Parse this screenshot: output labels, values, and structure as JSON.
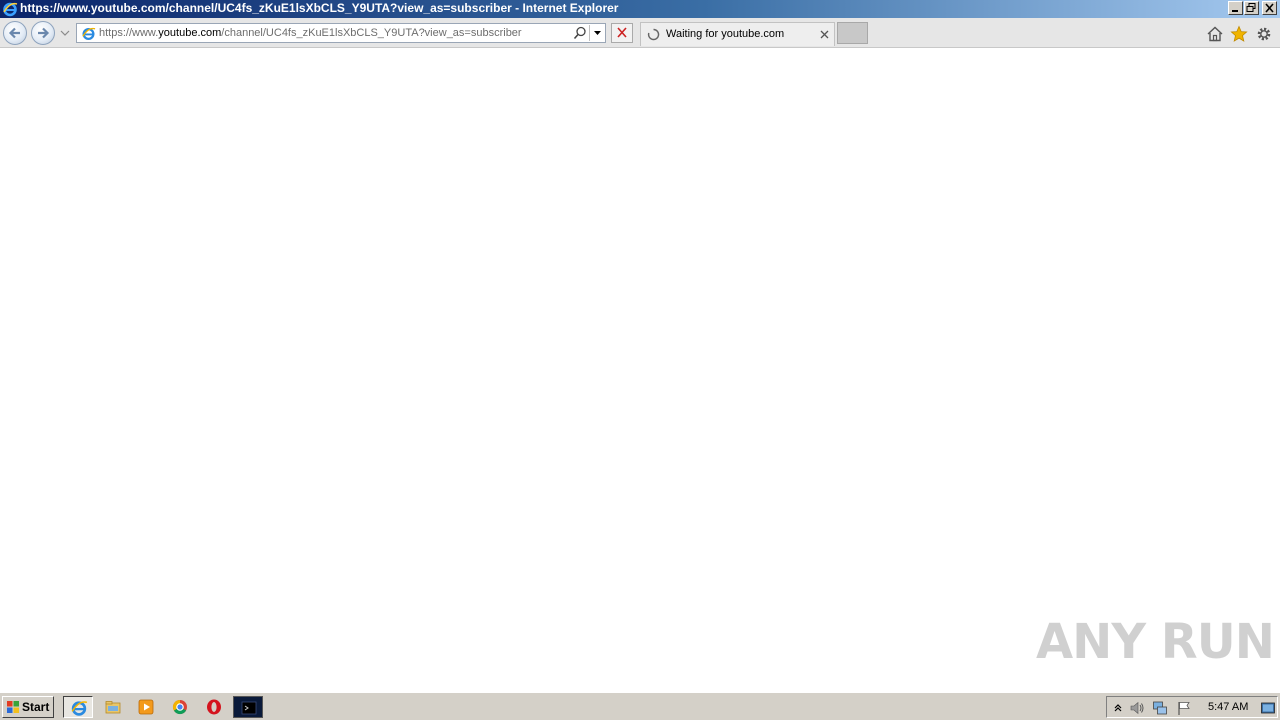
{
  "window": {
    "title": "https://www.youtube.com/channel/UC4fs_zKuE1lsXbCLS_Y9UTA?view_as=subscriber - Internet Explorer"
  },
  "address": {
    "prefix": "https://www.",
    "host": "youtube.com",
    "path": "/channel/UC4fs_zKuE1lsXbCLS_Y9UTA?view_as=subscriber"
  },
  "tab": {
    "label": "Waiting for youtube.com"
  },
  "watermark": {
    "text": "ANY RUN"
  },
  "taskbar": {
    "start_label": "Start",
    "items": [
      "internet-explorer",
      "file-explorer",
      "media-player",
      "chrome",
      "opera",
      "terminal"
    ],
    "clock": "5:47 AM"
  },
  "colors": {
    "titlebar_start": "#0a246a",
    "titlebar_end": "#a6caf0",
    "stop_x": "#cc2222",
    "star": "#f0b400"
  }
}
